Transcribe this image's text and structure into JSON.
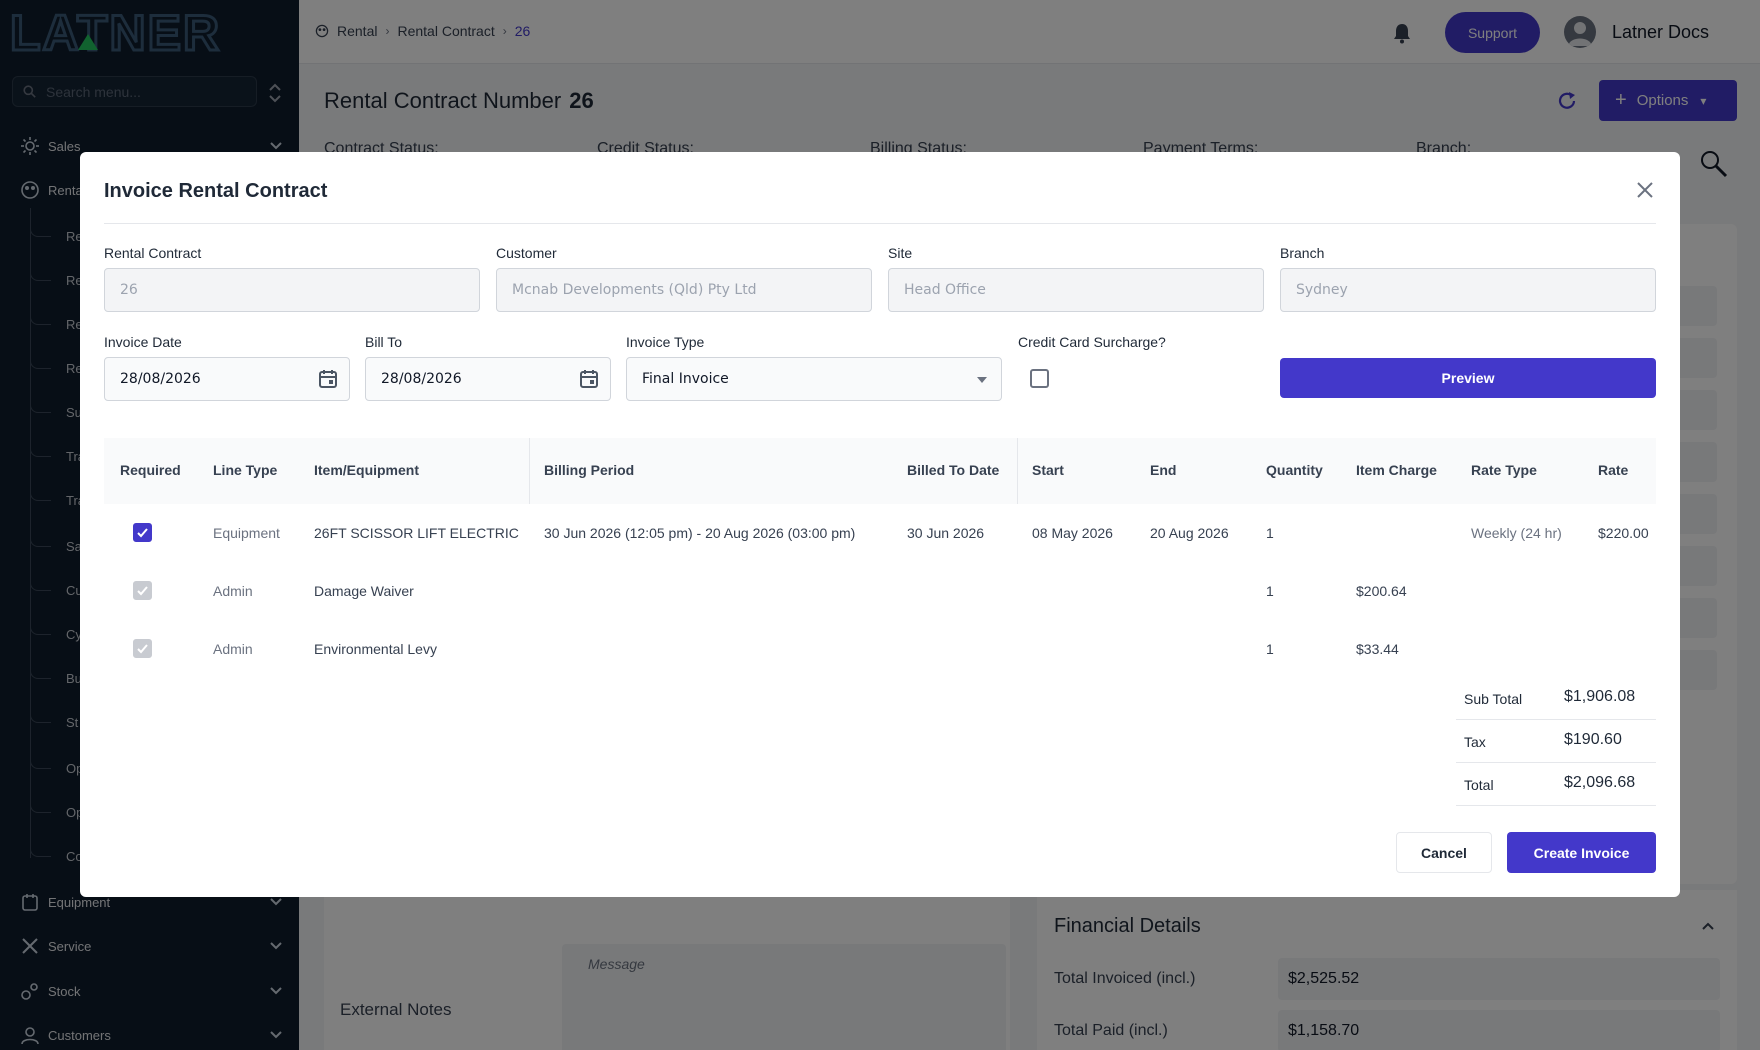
{
  "app": {
    "logo_text": "LATNER",
    "sidebar_search_placeholder": "Search menu...",
    "sidebar": {
      "items": [
        {
          "label": "Sales",
          "icon": "sales-icon"
        },
        {
          "label": "Rental",
          "icon": "rental-icon"
        },
        {
          "label": "Equipment",
          "icon": "equipment-icon"
        },
        {
          "label": "Service",
          "icon": "service-icon"
        },
        {
          "label": "Stock",
          "icon": "stock-icon"
        },
        {
          "label": "Customers",
          "icon": "customers-icon"
        }
      ],
      "sub_items": [
        "Re",
        "Re",
        "Re",
        "Re",
        "Su",
        "Tra",
        "Tra",
        "Sa",
        "Cu",
        "Cy",
        "Bu",
        "St",
        "Op",
        "Op",
        "Co"
      ]
    }
  },
  "topbar": {
    "breadcrumb": [
      "Rental",
      "Rental Contract",
      "26"
    ],
    "support_label": "Support",
    "user_name": "Latner Docs"
  },
  "page": {
    "title": "Rental Contract Number",
    "number": "26",
    "options_label": "Options",
    "status_labels": [
      "Contract Status:",
      "Credit Status:",
      "Billing Status:",
      "Payment Terms:",
      "Branch:"
    ],
    "external_notes_label": "External Notes",
    "message_placeholder": "Message",
    "financial": {
      "title": "Financial Details",
      "rows": [
        {
          "label": "Total Invoiced (incl.)",
          "value": "$2,525.52"
        },
        {
          "label": "Total Paid (incl.)",
          "value": "$1,158.70"
        }
      ]
    }
  },
  "modal": {
    "title": "Invoice Rental Contract",
    "fields": {
      "rental_contract": {
        "label": "Rental Contract",
        "value": "26"
      },
      "customer": {
        "label": "Customer",
        "value": "Mcnab Developments (Qld) Pty Ltd"
      },
      "site": {
        "label": "Site",
        "value": "Head Office"
      },
      "branch": {
        "label": "Branch",
        "value": "Sydney"
      },
      "invoice_date": {
        "label": "Invoice Date",
        "value": "28/08/2026"
      },
      "bill_to": {
        "label": "Bill To",
        "value": "28/08/2026"
      },
      "invoice_type": {
        "label": "Invoice Type",
        "value": "Final Invoice"
      },
      "surcharge": {
        "label": "Credit Card Surcharge?",
        "checked": false
      }
    },
    "preview_label": "Preview",
    "table": {
      "headers": [
        "Required",
        "Line Type",
        "Item/Equipment",
        "Billing Period",
        "Billed To Date",
        "Start",
        "End",
        "Quantity",
        "Item Charge",
        "Rate Type",
        "Rate"
      ],
      "rows": [
        {
          "required": true,
          "line_type": "Equipment",
          "item": "26FT SCISSOR LIFT ELECTRIC",
          "billing_period": "30 Jun 2026 (12:05 pm) - 20 Aug 2026 (03:00 pm)",
          "billed_to": "30 Jun 2026",
          "start": "08 May 2026",
          "end": "20 Aug 2026",
          "quantity": "1",
          "item_charge": "",
          "rate_type": "Weekly (24 hr)",
          "rate": "$220.00"
        },
        {
          "required": true,
          "line_type": "Admin",
          "item": "Damage Waiver",
          "billing_period": "",
          "billed_to": "",
          "start": "",
          "end": "",
          "quantity": "1",
          "item_charge": "$200.64",
          "rate_type": "",
          "rate": ""
        },
        {
          "required": true,
          "line_type": "Admin",
          "item": "Environmental Levy",
          "billing_period": "",
          "billed_to": "",
          "start": "",
          "end": "",
          "quantity": "1",
          "item_charge": "$33.44",
          "rate_type": "",
          "rate": ""
        }
      ]
    },
    "totals": {
      "sub_total": {
        "label": "Sub Total",
        "value": "$1,906.08"
      },
      "tax": {
        "label": "Tax",
        "value": "$190.60"
      },
      "total": {
        "label": "Total",
        "value": "$2,096.68"
      }
    },
    "cancel_label": "Cancel",
    "create_label": "Create Invoice"
  },
  "colors": {
    "accent": "#4338ca",
    "sidebar_bg": "#0f1d2c",
    "overlay": "rgba(0,0,0,0.5)"
  }
}
